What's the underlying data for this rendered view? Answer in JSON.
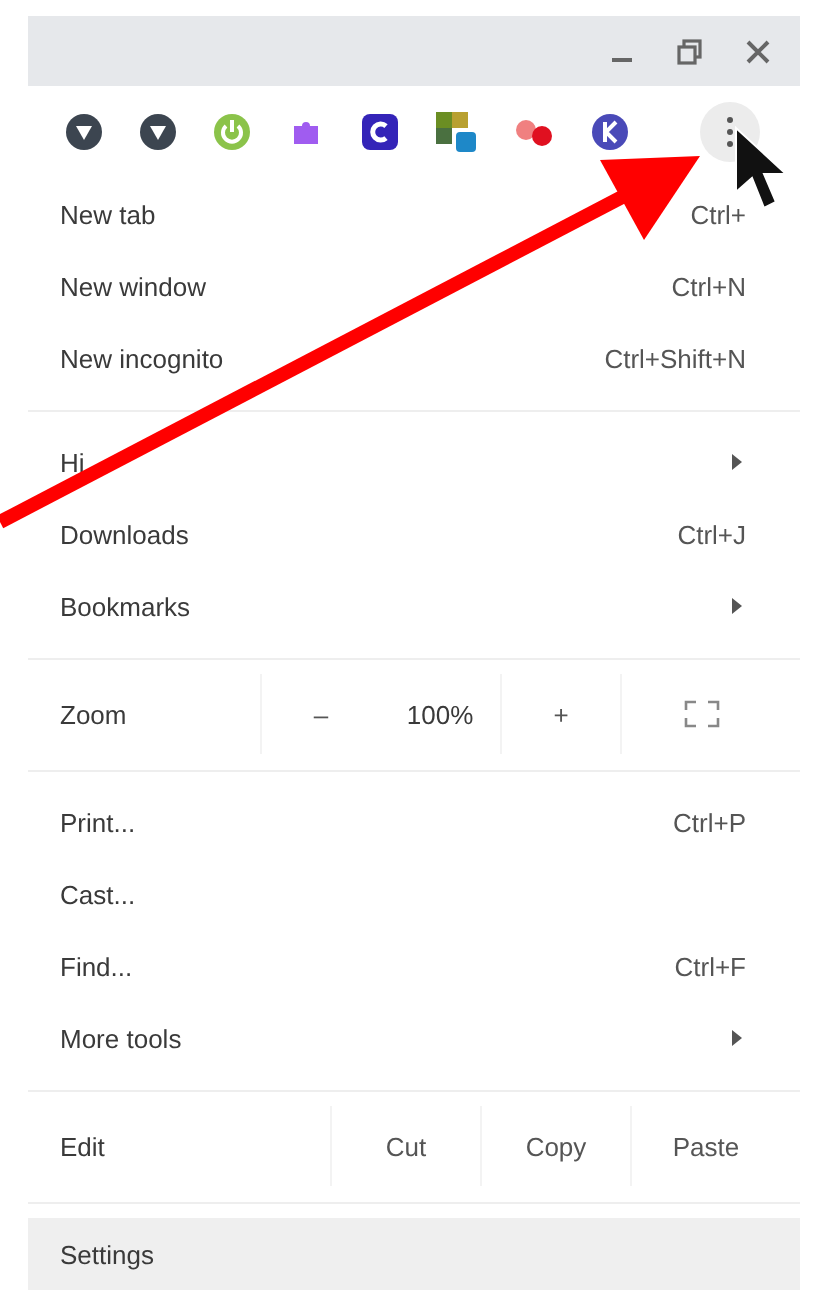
{
  "menu": {
    "sections": [
      [
        {
          "kind": "item",
          "label": "New tab",
          "shortcut": "Ctrl+"
        },
        {
          "kind": "item",
          "label": "New window",
          "shortcut": "Ctrl+N"
        },
        {
          "kind": "item",
          "label": "New incognito",
          "shortcut": "Ctrl+Shift+N"
        }
      ],
      [
        {
          "kind": "submenu",
          "label": "Hi"
        },
        {
          "kind": "item",
          "label": "Downloads",
          "shortcut": "Ctrl+J"
        },
        {
          "kind": "submenu",
          "label": "Bookmarks"
        }
      ],
      [
        {
          "kind": "zoom",
          "label": "Zoom",
          "minus": "–",
          "value": "100%",
          "plus": "+"
        }
      ],
      [
        {
          "kind": "item",
          "label": "Print...",
          "shortcut": "Ctrl+P"
        },
        {
          "kind": "item",
          "label": "Cast..."
        },
        {
          "kind": "item",
          "label": "Find...",
          "shortcut": "Ctrl+F"
        },
        {
          "kind": "submenu",
          "label": "More tools"
        }
      ],
      [
        {
          "kind": "edit",
          "label": "Edit",
          "cut": "Cut",
          "copy": "Copy",
          "paste": "Paste"
        }
      ],
      [
        {
          "kind": "item",
          "label": "Settings",
          "highlighted": true
        }
      ]
    ]
  }
}
